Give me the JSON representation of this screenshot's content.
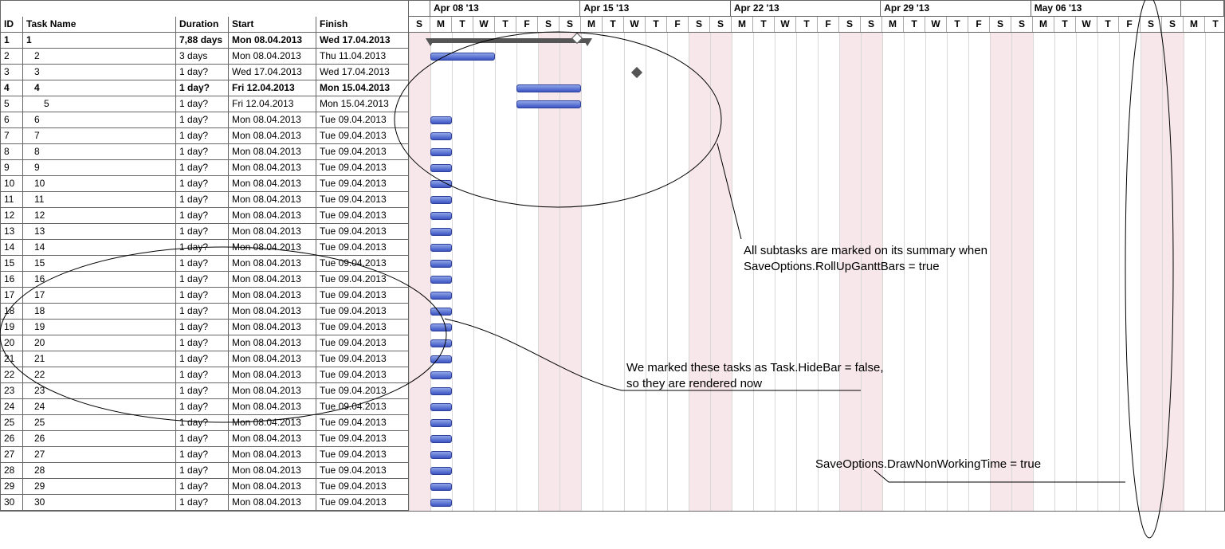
{
  "columns": {
    "id": "ID",
    "name": "Task Name",
    "dur": "Duration",
    "start": "Start",
    "fin": "Finish"
  },
  "weeks": [
    {
      "label": "",
      "days": 1,
      "dayLabels": [
        "S"
      ]
    },
    {
      "label": "Apr 08 '13",
      "days": 7,
      "dayLabels": [
        "M",
        "T",
        "W",
        "T",
        "F",
        "S",
        "S"
      ]
    },
    {
      "label": "Apr 15 '13",
      "days": 7,
      "dayLabels": [
        "M",
        "T",
        "W",
        "T",
        "F",
        "S",
        "S"
      ]
    },
    {
      "label": "Apr 22 '13",
      "days": 7,
      "dayLabels": [
        "M",
        "T",
        "W",
        "T",
        "F",
        "S",
        "S"
      ]
    },
    {
      "label": "Apr 29 '13",
      "days": 7,
      "dayLabels": [
        "M",
        "T",
        "W",
        "T",
        "F",
        "S",
        "S"
      ]
    },
    {
      "label": "May 06 '13",
      "days": 7,
      "dayLabels": [
        "M",
        "T",
        "W",
        "T",
        "F",
        "S",
        "S"
      ]
    },
    {
      "label": "",
      "days": 2,
      "dayLabels": [
        "M",
        "T"
      ]
    }
  ],
  "tasks": [
    {
      "id": "1",
      "name": "1",
      "indent": 0,
      "bold": true,
      "dur": "7,88 days",
      "start": "Mon 08.04.2013",
      "fin": "Wed 17.04.2013",
      "barType": "summary",
      "barStart": 1,
      "barLen": 7.3,
      "markers": [
        {
          "type": "rollup",
          "day": 7.8
        }
      ]
    },
    {
      "id": "2",
      "name": "2",
      "indent": 1,
      "dur": "3 days",
      "start": "Mon 08.04.2013",
      "fin": "Thu 11.04.2013",
      "barType": "task",
      "barStart": 1,
      "barLen": 3
    },
    {
      "id": "3",
      "name": "3",
      "indent": 1,
      "dur": "1 day?",
      "start": "Wed 17.04.2013",
      "fin": "Wed 17.04.2013",
      "barType": "milestone",
      "barStart": 10.6
    },
    {
      "id": "4",
      "name": "4",
      "indent": 1,
      "bold": true,
      "dur": "1 day?",
      "start": "Fri 12.04.2013",
      "fin": "Mon 15.04.2013",
      "barType": "task",
      "barStart": 5,
      "barLen": 3
    },
    {
      "id": "5",
      "name": "5",
      "indent": 2,
      "dur": "1 day?",
      "start": "Fri 12.04.2013",
      "fin": "Mon 15.04.2013",
      "barType": "task",
      "barStart": 5,
      "barLen": 3
    },
    {
      "id": "6",
      "name": "6",
      "indent": 1,
      "dur": "1 day?",
      "start": "Mon 08.04.2013",
      "fin": "Tue 09.04.2013",
      "barType": "task",
      "barStart": 1,
      "barLen": 1
    },
    {
      "id": "7",
      "name": "7",
      "indent": 1,
      "dur": "1 day?",
      "start": "Mon 08.04.2013",
      "fin": "Tue 09.04.2013",
      "barType": "task",
      "barStart": 1,
      "barLen": 1
    },
    {
      "id": "8",
      "name": "8",
      "indent": 1,
      "dur": "1 day?",
      "start": "Mon 08.04.2013",
      "fin": "Tue 09.04.2013",
      "barType": "task",
      "barStart": 1,
      "barLen": 1
    },
    {
      "id": "9",
      "name": "9",
      "indent": 1,
      "dur": "1 day?",
      "start": "Mon 08.04.2013",
      "fin": "Tue 09.04.2013",
      "barType": "task",
      "barStart": 1,
      "barLen": 1
    },
    {
      "id": "10",
      "name": "10",
      "indent": 1,
      "dur": "1 day?",
      "start": "Mon 08.04.2013",
      "fin": "Tue 09.04.2013",
      "barType": "task",
      "barStart": 1,
      "barLen": 1
    },
    {
      "id": "11",
      "name": "11",
      "indent": 1,
      "dur": "1 day?",
      "start": "Mon 08.04.2013",
      "fin": "Tue 09.04.2013",
      "barType": "task",
      "barStart": 1,
      "barLen": 1
    },
    {
      "id": "12",
      "name": "12",
      "indent": 1,
      "dur": "1 day?",
      "start": "Mon 08.04.2013",
      "fin": "Tue 09.04.2013",
      "barType": "task",
      "barStart": 1,
      "barLen": 1
    },
    {
      "id": "13",
      "name": "13",
      "indent": 1,
      "dur": "1 day?",
      "start": "Mon 08.04.2013",
      "fin": "Tue 09.04.2013",
      "barType": "task",
      "barStart": 1,
      "barLen": 1
    },
    {
      "id": "14",
      "name": "14",
      "indent": 1,
      "dur": "1 day?",
      "start": "Mon 08.04.2013",
      "fin": "Tue 09.04.2013",
      "barType": "task",
      "barStart": 1,
      "barLen": 1
    },
    {
      "id": "15",
      "name": "15",
      "indent": 1,
      "dur": "1 day?",
      "start": "Mon 08.04.2013",
      "fin": "Tue 09.04.2013",
      "barType": "task",
      "barStart": 1,
      "barLen": 1
    },
    {
      "id": "16",
      "name": "16",
      "indent": 1,
      "dur": "1 day?",
      "start": "Mon 08.04.2013",
      "fin": "Tue 09.04.2013",
      "barType": "task",
      "barStart": 1,
      "barLen": 1
    },
    {
      "id": "17",
      "name": "17",
      "indent": 1,
      "dur": "1 day?",
      "start": "Mon 08.04.2013",
      "fin": "Tue 09.04.2013",
      "barType": "task",
      "barStart": 1,
      "barLen": 1
    },
    {
      "id": "18",
      "name": "18",
      "indent": 1,
      "dur": "1 day?",
      "start": "Mon 08.04.2013",
      "fin": "Tue 09.04.2013",
      "barType": "task",
      "barStart": 1,
      "barLen": 1
    },
    {
      "id": "19",
      "name": "19",
      "indent": 1,
      "dur": "1 day?",
      "start": "Mon 08.04.2013",
      "fin": "Tue 09.04.2013",
      "barType": "task",
      "barStart": 1,
      "barLen": 1
    },
    {
      "id": "20",
      "name": "20",
      "indent": 1,
      "dur": "1 day?",
      "start": "Mon 08.04.2013",
      "fin": "Tue 09.04.2013",
      "barType": "task",
      "barStart": 1,
      "barLen": 1
    },
    {
      "id": "21",
      "name": "21",
      "indent": 1,
      "dur": "1 day?",
      "start": "Mon 08.04.2013",
      "fin": "Tue 09.04.2013",
      "barType": "task",
      "barStart": 1,
      "barLen": 1
    },
    {
      "id": "22",
      "name": "22",
      "indent": 1,
      "dur": "1 day?",
      "start": "Mon 08.04.2013",
      "fin": "Tue 09.04.2013",
      "barType": "task",
      "barStart": 1,
      "barLen": 1
    },
    {
      "id": "23",
      "name": "23",
      "indent": 1,
      "dur": "1 day?",
      "start": "Mon 08.04.2013",
      "fin": "Tue 09.04.2013",
      "barType": "task",
      "barStart": 1,
      "barLen": 1
    },
    {
      "id": "24",
      "name": "24",
      "indent": 1,
      "dur": "1 day?",
      "start": "Mon 08.04.2013",
      "fin": "Tue 09.04.2013",
      "barType": "task",
      "barStart": 1,
      "barLen": 1
    },
    {
      "id": "25",
      "name": "25",
      "indent": 1,
      "dur": "1 day?",
      "start": "Mon 08.04.2013",
      "fin": "Tue 09.04.2013",
      "barType": "task",
      "barStart": 1,
      "barLen": 1
    },
    {
      "id": "26",
      "name": "26",
      "indent": 1,
      "dur": "1 day?",
      "start": "Mon 08.04.2013",
      "fin": "Tue 09.04.2013",
      "barType": "task",
      "barStart": 1,
      "barLen": 1
    },
    {
      "id": "27",
      "name": "27",
      "indent": 1,
      "dur": "1 day?",
      "start": "Mon 08.04.2013",
      "fin": "Tue 09.04.2013",
      "barType": "task",
      "barStart": 1,
      "barLen": 1
    },
    {
      "id": "28",
      "name": "28",
      "indent": 1,
      "dur": "1 day?",
      "start": "Mon 08.04.2013",
      "fin": "Tue 09.04.2013",
      "barType": "task",
      "barStart": 1,
      "barLen": 1
    },
    {
      "id": "29",
      "name": "29",
      "indent": 1,
      "dur": "1 day?",
      "start": "Mon 08.04.2013",
      "fin": "Tue 09.04.2013",
      "barType": "task",
      "barStart": 1,
      "barLen": 1
    },
    {
      "id": "30",
      "name": "30",
      "indent": 1,
      "dur": "1 day?",
      "start": "Mon 08.04.2013",
      "fin": "Tue 09.04.2013",
      "barType": "task",
      "barStart": 1,
      "barLen": 1
    }
  ],
  "dayWidth": 27,
  "weekendDays": [
    0,
    6,
    7,
    13,
    14,
    20,
    21,
    27,
    28,
    34,
    35
  ],
  "annotations": {
    "a1_line1": "All subtasks are marked on its summary when",
    "a1_line2": "SaveOptions.RollUpGanttBars = true",
    "a2_line1": "We marked these tasks as Task.HideBar = false,",
    "a2_line2": "so they are rendered now",
    "a3": "SaveOptions.DrawNonWorkingTime = true"
  }
}
